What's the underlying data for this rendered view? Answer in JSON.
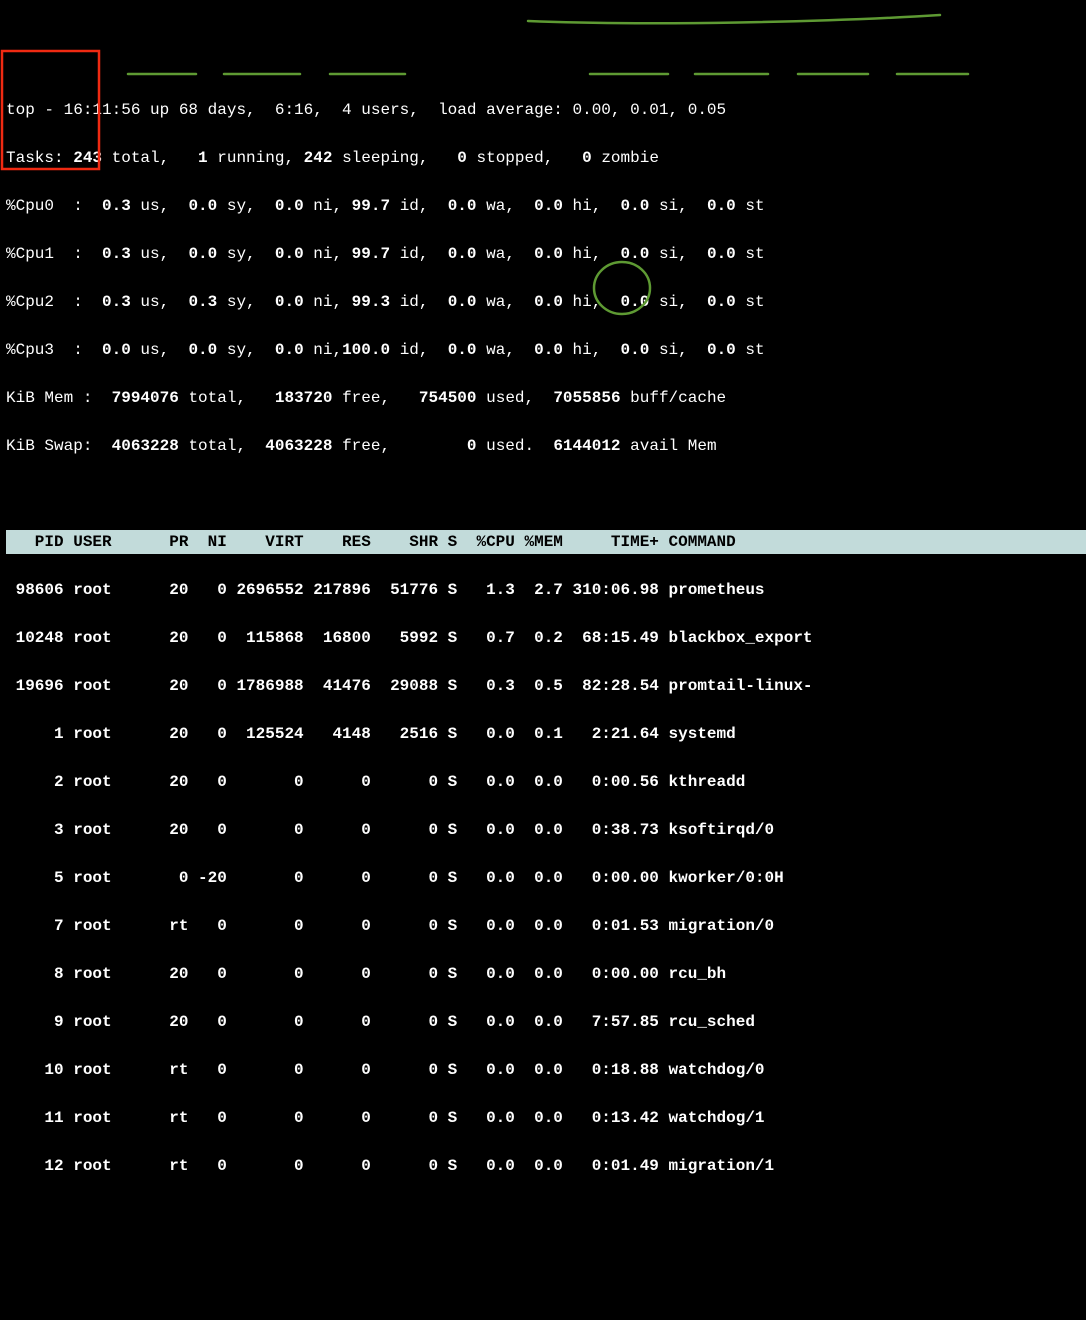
{
  "summary": {
    "line1": "top - 16:11:56 up 68 days,  6:16,  4 users,  load average: 0.00, 0.01, 0.05",
    "line2": "Tasks: 243 total,   1 running, 242 sleeping,   0 stopped,   0 zombie",
    "cpu": [
      "%Cpu0  :  0.3 us,  0.0 sy,  0.0 ni, 99.7 id,  0.0 wa,  0.0 hi,  0.0 si,  0.0 st",
      "%Cpu1  :  0.3 us,  0.0 sy,  0.0 ni, 99.7 id,  0.0 wa,  0.0 hi,  0.0 si,  0.0 st",
      "%Cpu2  :  0.3 us,  0.3 sy,  0.0 ni, 99.3 id,  0.0 wa,  0.0 hi,  0.0 si,  0.0 st",
      "%Cpu3  :  0.0 us,  0.0 sy,  0.0 ni,100.0 id,  0.0 wa,  0.0 hi,  0.0 si,  0.0 st"
    ],
    "mem": "KiB Mem :  7994076 total,   183720 free,   754500 used,  7055856 buff/cache",
    "swap": "KiB Swap:  4063228 total,  4063228 free,        0 used.  6144012 avail Mem "
  },
  "header": "   PID USER      PR  NI    VIRT    RES    SHR S  %CPU %MEM     TIME+ COMMAND         ",
  "procs": [
    " 98606 root      20   0 2696552 217896  51776 S   1.3  2.7 310:06.98 prometheus      ",
    " 10248 root      20   0  115868  16800   5992 S   0.7  0.2  68:15.49 blackbox_export ",
    " 19696 root      20   0 1786988  41476  29088 S   0.3  0.5  82:28.54 promtail-linux- ",
    "     1 root      20   0  125524   4148   2516 S   0.0  0.1   2:21.64 systemd         ",
    "     2 root      20   0       0      0      0 S   0.0  0.0   0:00.56 kthreadd        ",
    "     3 root      20   0       0      0      0 S   0.0  0.0   0:38.73 ksoftirqd/0     ",
    "     5 root       0 -20       0      0      0 S   0.0  0.0   0:00.00 kworker/0:0H    ",
    "     7 root      rt   0       0      0      0 S   0.0  0.0   0:01.53 migration/0     ",
    "     8 root      20   0       0      0      0 S   0.0  0.0   0:00.00 rcu_bh          ",
    "     9 root      20   0       0      0      0 S   0.0  0.0   7:57.85 rcu_sched       ",
    "    10 root      rt   0       0      0      0 S   0.0  0.0   0:18.88 watchdog/0      ",
    "    11 root      rt   0       0      0      0 S   0.0  0.0   0:13.42 watchdog/1      ",
    "    12 root      rt   0       0      0      0 S   0.0  0.0   0:01.49 migration/1     "
  ]
}
